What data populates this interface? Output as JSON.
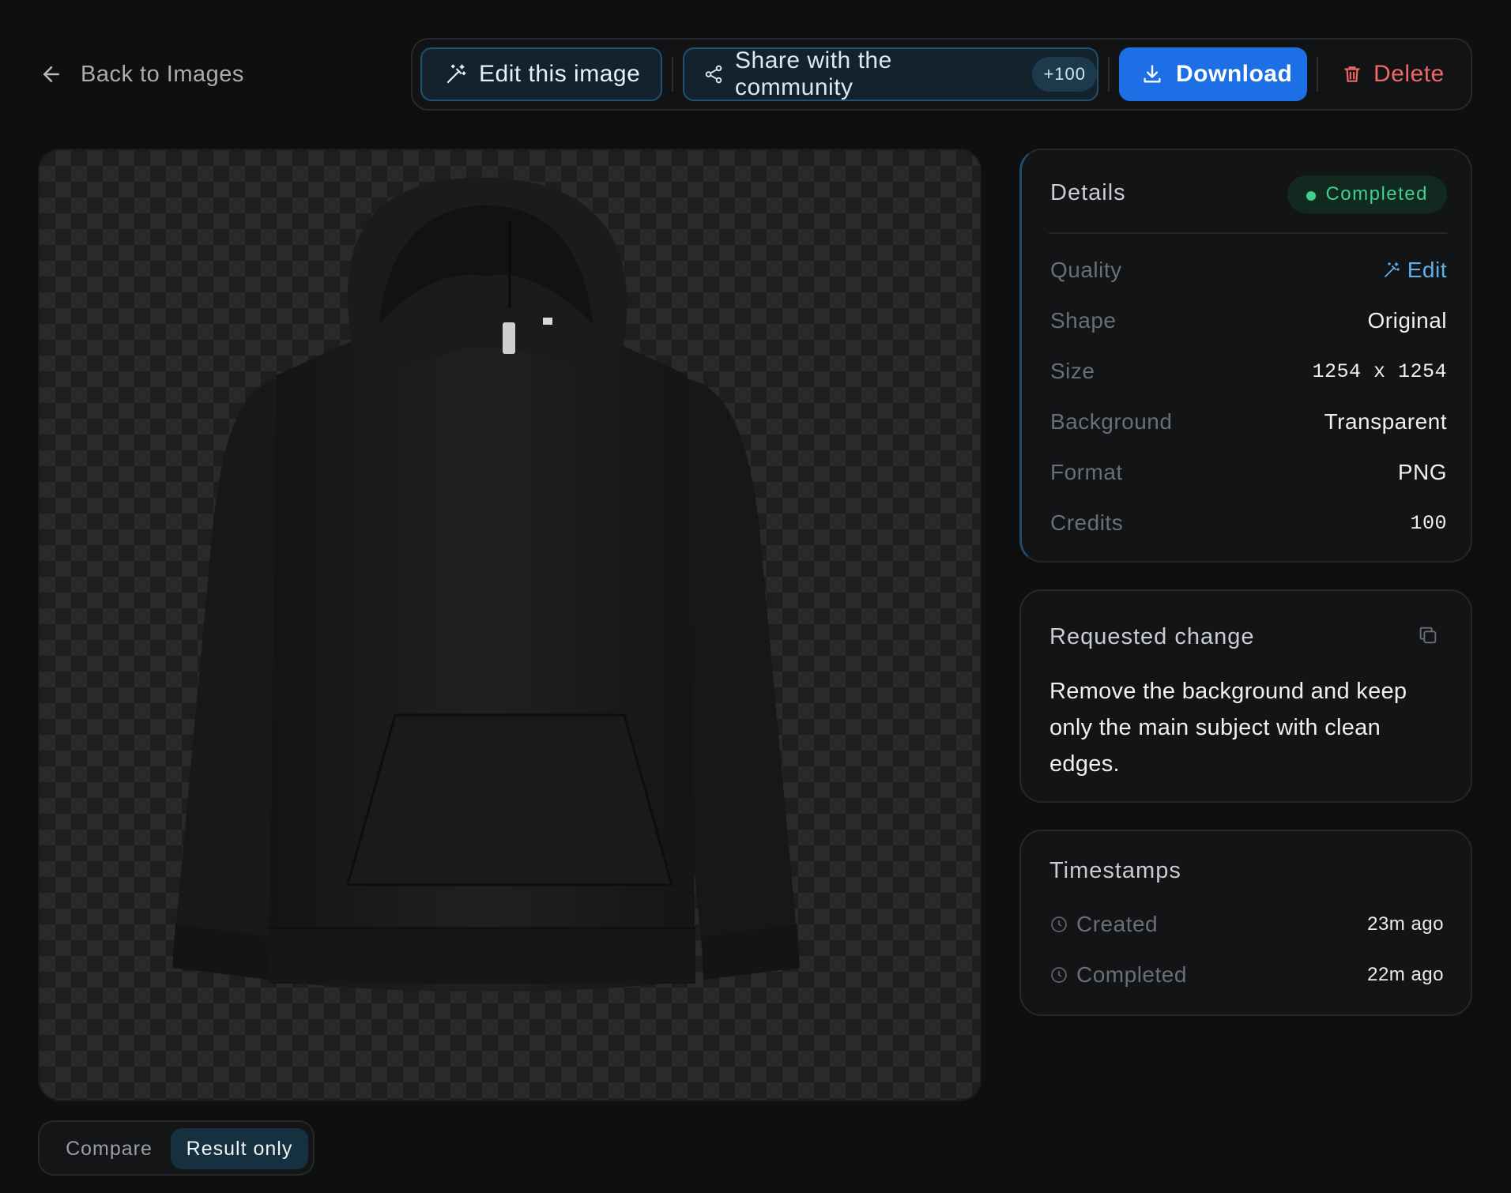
{
  "nav": {
    "back_label": "Back to Images"
  },
  "toolbar": {
    "edit_label": "Edit this image",
    "share_label": "Share with the community",
    "share_credits": "+100",
    "download_label": "Download",
    "delete_label": "Delete"
  },
  "view_toggle": {
    "compare_label": "Compare",
    "result_label": "Result only",
    "selected": "Result only"
  },
  "details": {
    "title": "Details",
    "status": "Completed",
    "rows": [
      {
        "key": "Quality",
        "value": "Edit"
      },
      {
        "key": "Shape",
        "value": "Original"
      },
      {
        "key": "Size",
        "value": "1254 x 1254"
      },
      {
        "key": "Background",
        "value": "Transparent"
      },
      {
        "key": "Format",
        "value": "PNG"
      },
      {
        "key": "Credits",
        "value": "100"
      }
    ]
  },
  "request": {
    "title": "Requested change",
    "text": "Remove the background and keep only the main subject with clean edges."
  },
  "timestamps": {
    "title": "Timestamps",
    "rows": [
      {
        "key": "Created",
        "value": "23m ago"
      },
      {
        "key": "Completed",
        "value": "22m ago"
      }
    ]
  },
  "colors": {
    "accent": "#1d6fe6",
    "status_green": "#3fcf8e",
    "danger": "#ef6868",
    "link": "#5fb0ea"
  },
  "icons": [
    "arrow-left-icon",
    "magic-wand-icon",
    "share-nodes-icon",
    "download-icon",
    "trash-icon",
    "copy-icon",
    "clock-icon"
  ]
}
